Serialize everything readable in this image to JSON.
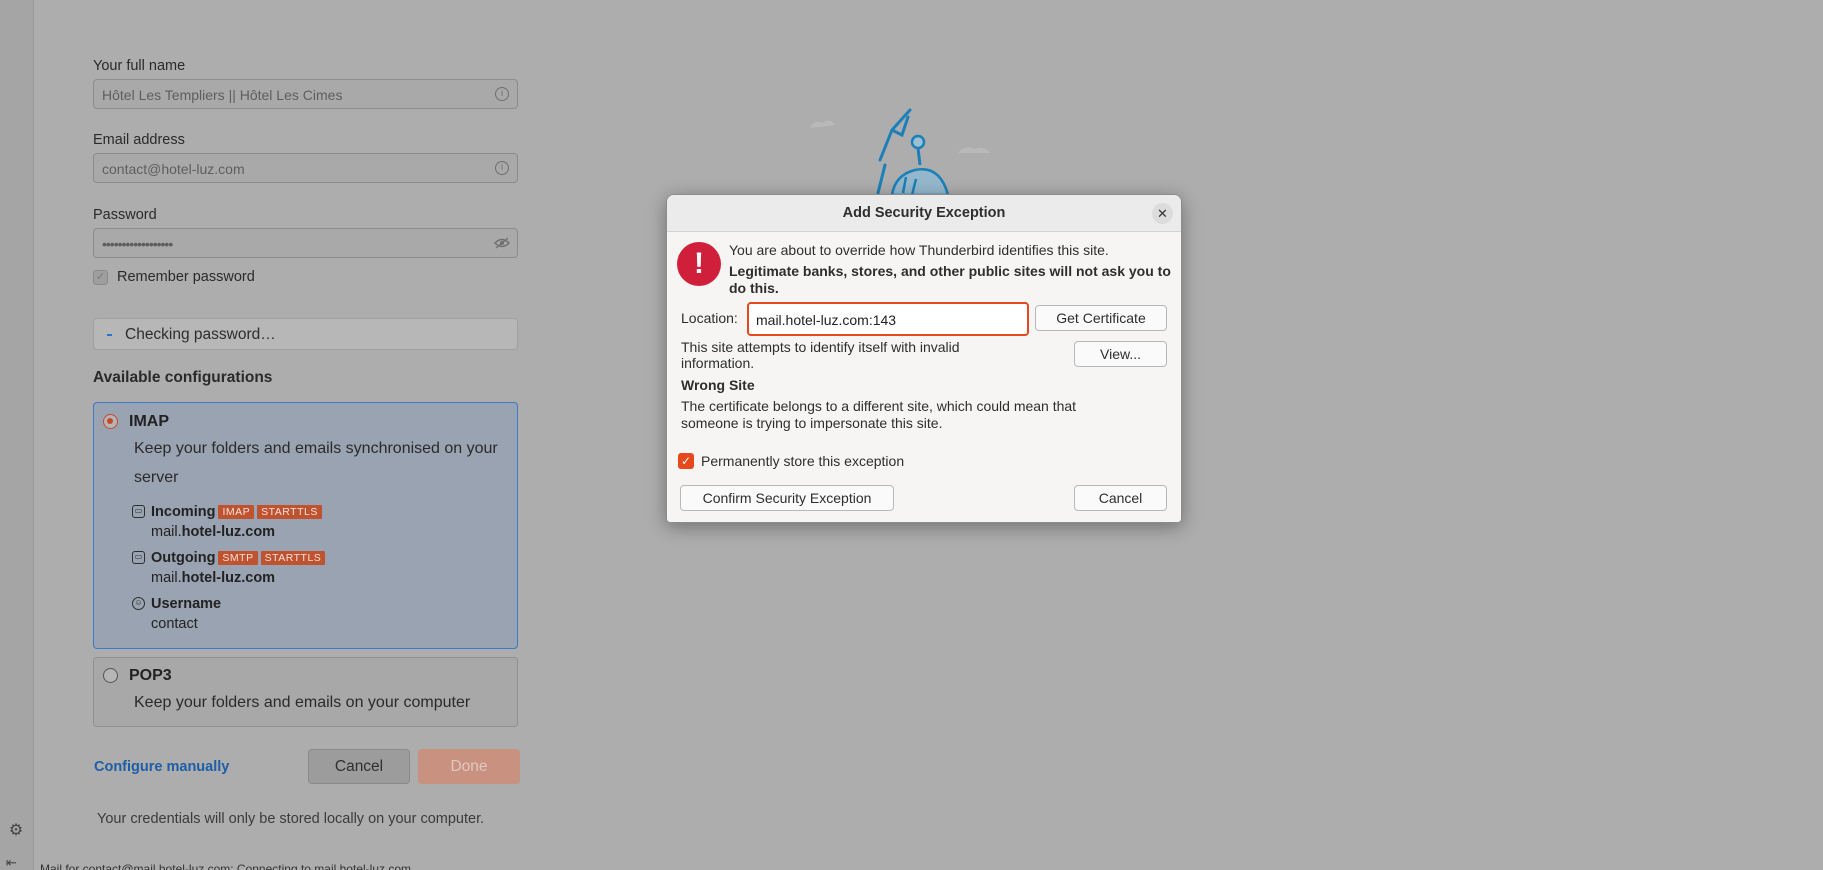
{
  "form": {
    "fullname_label": "Your full name",
    "fullname_value": "Hôtel Les Templiers || Hôtel Les Cimes",
    "email_label": "Email address",
    "email_value": "contact@hotel-luz.com",
    "password_label": "Password",
    "password_value": "••••••••••••••••••",
    "remember_label": "Remember password",
    "checking_text": "Checking password…",
    "available_title": "Available configurations",
    "imap": {
      "name": "IMAP",
      "description": "Keep your folders and emails synchronised on your server",
      "incoming_label": "Incoming",
      "incoming_tags": [
        "IMAP",
        "STARTTLS"
      ],
      "incoming_host_prefix": "mail.",
      "incoming_host_domain": "hotel-luz.com",
      "outgoing_label": "Outgoing",
      "outgoing_tags": [
        "SMTP",
        "STARTTLS"
      ],
      "outgoing_host_prefix": "mail.",
      "outgoing_host_domain": "hotel-luz.com",
      "username_label": "Username",
      "username_value": "contact"
    },
    "pop3": {
      "name": "POP3",
      "description": "Keep your folders and emails on your computer"
    },
    "configure_manually": "Configure manually",
    "cancel_label": "Cancel",
    "done_label": "Done",
    "footnote": "Your credentials will only be stored locally on your computer.",
    "status_text": "Mail for contact@mail.hotel-luz.com: Connecting to mail.hotel-luz.com..."
  },
  "dialog": {
    "title": "Add Security Exception",
    "message": "You are about to override how Thunderbird identifies this site.",
    "warning": "Legitimate banks, stores, and other public sites will not ask you to do this.",
    "location_label": "Location:",
    "location_value": "mail.hotel-luz.com:143",
    "get_certificate_label": "Get Certificate",
    "info_text": "This site attempts to identify itself with invalid information.",
    "view_label": "View...",
    "wrong_site_title": "Wrong Site",
    "wrong_site_desc": "The certificate belongs to a different site, which could mean that someone is trying to impersonate this site.",
    "permanent_label": "Permanently store this exception",
    "confirm_label": "Confirm Security Exception",
    "cancel_label": "Cancel"
  },
  "colors": {
    "accent": "#e5491d",
    "alert": "#d01f3b",
    "link": "#1d5ea8",
    "selected_border": "#3b79c9"
  }
}
